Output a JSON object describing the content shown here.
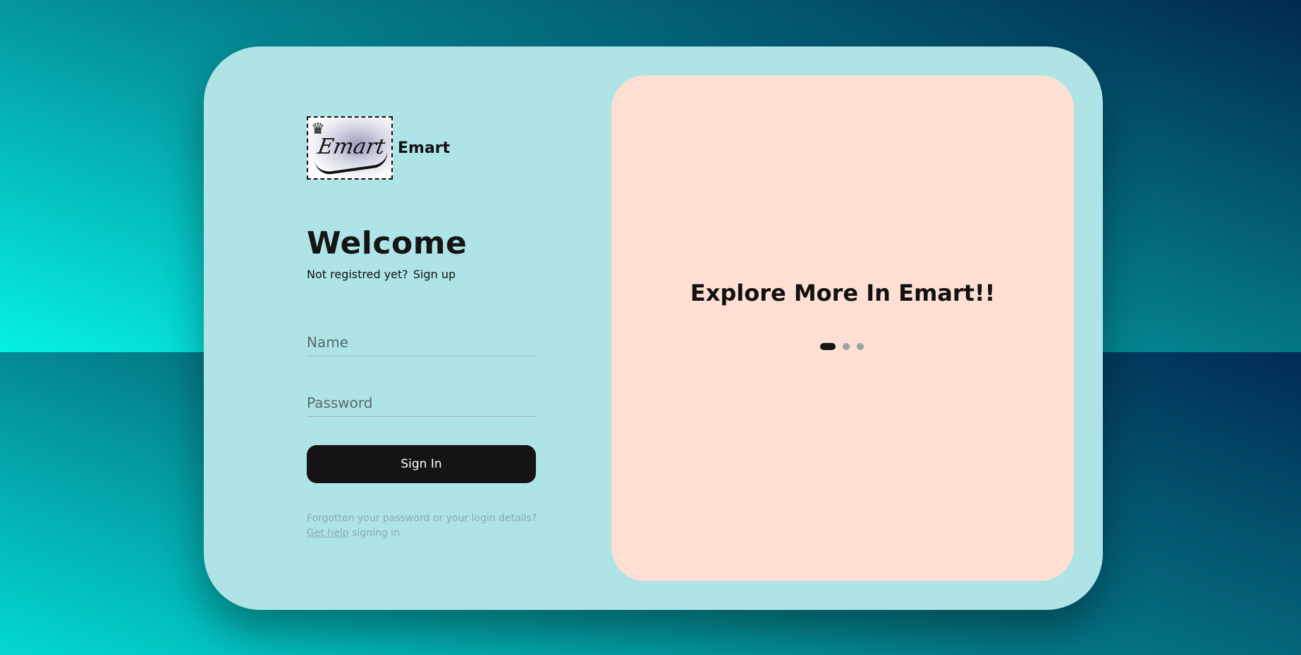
{
  "brand": {
    "name": "Emart",
    "logo_text": "Emart"
  },
  "login": {
    "title": "Welcome",
    "register_prompt": "Not registred yet?",
    "register_link": "Sign up",
    "name_placeholder": "Name",
    "password_placeholder": "Password",
    "signin_label": "Sign In",
    "help_text": "Forgotten your password or your login details?",
    "help_link": "Get help",
    "help_suffix": "signing in"
  },
  "promo": {
    "headline": "Explore More In Emart!!",
    "active_slide": 1,
    "slide_count": 3
  },
  "colors": {
    "card": "#aee4e5",
    "promo_panel": "#fedfd3",
    "button": "#161314",
    "button_text": "#ffffff"
  }
}
